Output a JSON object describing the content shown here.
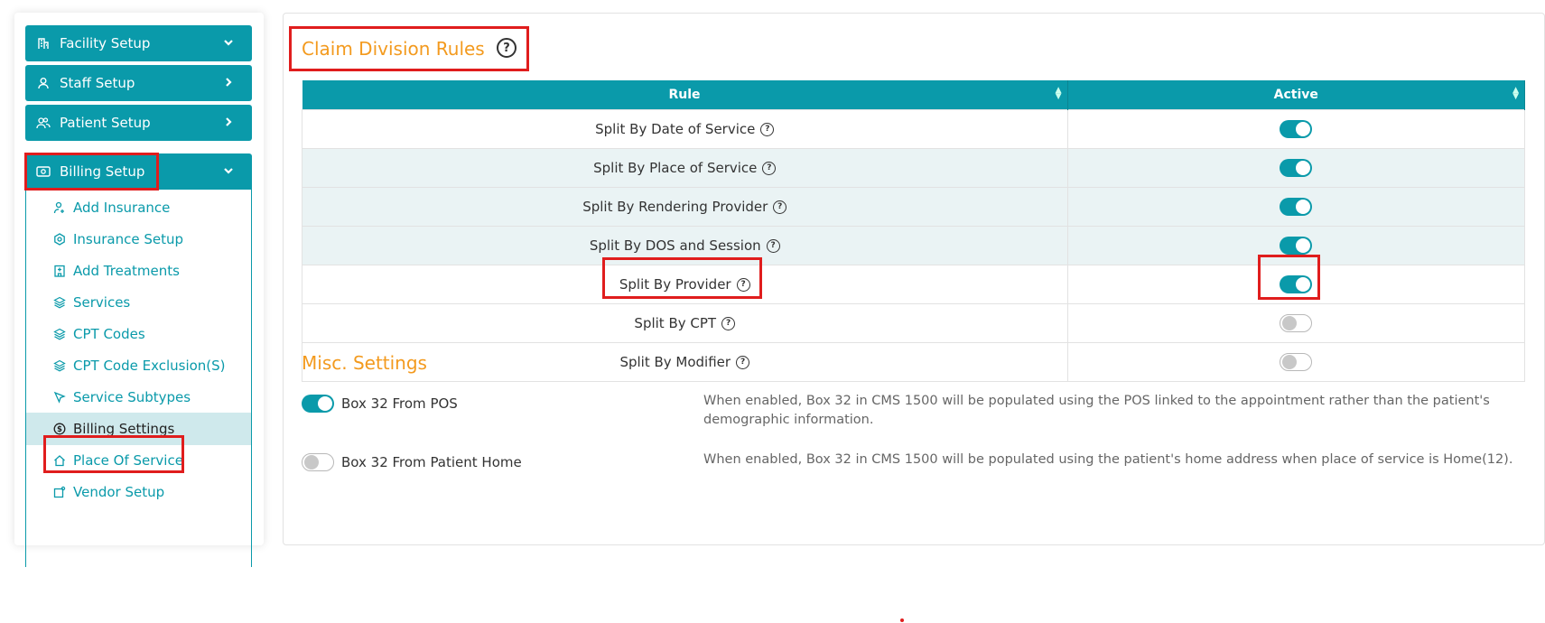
{
  "sidebar": {
    "sections": [
      {
        "label": "Facility Setup",
        "icon": "building-icon",
        "chevron": "down"
      },
      {
        "label": "Staff Setup",
        "icon": "user-icon",
        "chevron": "right"
      },
      {
        "label": "Patient Setup",
        "icon": "users-icon",
        "chevron": "right"
      },
      {
        "label": "Billing Setup",
        "icon": "money-icon",
        "chevron": "down"
      }
    ],
    "billing_items": [
      {
        "label": "Add Insurance",
        "icon": "user-plus-icon"
      },
      {
        "label": "Insurance Setup",
        "icon": "hexagon-icon"
      },
      {
        "label": "Add Treatments",
        "icon": "hospital-icon"
      },
      {
        "label": "Services",
        "icon": "layers-icon"
      },
      {
        "label": "CPT Codes",
        "icon": "layers-icon"
      },
      {
        "label": "CPT Code Exclusion(S)",
        "icon": "layers-icon"
      },
      {
        "label": "Service Subtypes",
        "icon": "pointer-icon"
      },
      {
        "label": "Billing Settings",
        "icon": "dollar-circle-icon",
        "active": true
      },
      {
        "label": "Place Of Service",
        "icon": "home-icon"
      },
      {
        "label": "Vendor Setup",
        "icon": "vendor-icon"
      }
    ]
  },
  "claim_rules": {
    "title": "Claim Division Rules",
    "help": "?",
    "columns": [
      "Rule",
      "Active"
    ],
    "rows": [
      {
        "rule": "Split By Date of Service",
        "active": true
      },
      {
        "rule": "Split By Place of Service",
        "active": true
      },
      {
        "rule": "Split By Rendering Provider",
        "active": true
      },
      {
        "rule": "Split By DOS and Session",
        "active": true
      },
      {
        "rule": "Split By Provider",
        "active": true
      },
      {
        "rule": "Split By CPT",
        "active": false
      },
      {
        "rule": "Split By Modifier",
        "active": false
      }
    ]
  },
  "misc": {
    "title": "Misc. Settings",
    "settings": [
      {
        "label": "Box 32 From POS",
        "enabled": true,
        "description": "When enabled, Box 32 in CMS 1500 will be populated using the POS linked to the appointment rather than the patient's demographic information."
      },
      {
        "label": "Box 32 From Patient Home",
        "enabled": false,
        "description": "When enabled, Box 32 in CMS 1500 will be populated using the patient's home address when place of service is Home(12)."
      }
    ]
  },
  "colors": {
    "accent": "#0a9aaa",
    "title_orange": "#f39a1e",
    "highlight_red": "#e01d1d"
  }
}
